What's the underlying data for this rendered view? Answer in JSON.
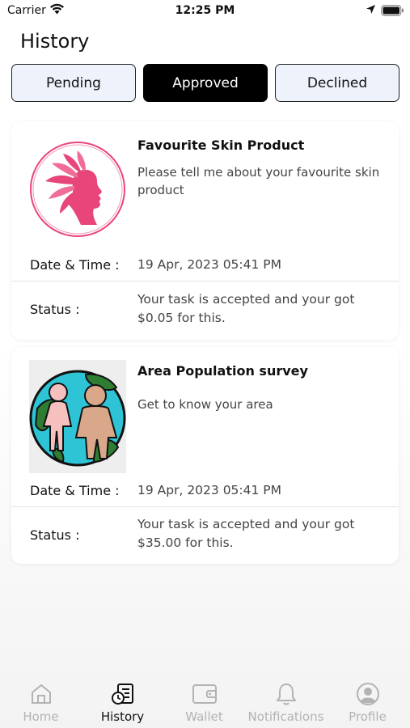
{
  "status_bar": {
    "carrier": "Carrier",
    "time": "12:25 PM"
  },
  "header": {
    "title": "History"
  },
  "segments": [
    {
      "label": "Pending",
      "active": false
    },
    {
      "label": "Approved",
      "active": true
    },
    {
      "label": "Declined",
      "active": false
    }
  ],
  "cards": [
    {
      "title": "Favourite Skin Product",
      "description": "Please tell me about your favourite skin product",
      "datetime_label": "Date & Time :",
      "datetime_value": "19 Apr, 2023 05:41 PM",
      "status_label": "Status :",
      "status_value": "Your task is accepted and your got $0.05 for this.",
      "image_icon": "woman-face-logo"
    },
    {
      "title": "Area Population survey",
      "description": "Get to know your area",
      "datetime_label": "Date & Time :",
      "datetime_value": "19 Apr, 2023 05:41 PM",
      "status_label": "Status :",
      "status_value": "Your task is accepted and your got $35.00 for this.",
      "image_icon": "globe-people-image"
    }
  ],
  "tab_bar": {
    "items": [
      {
        "label": "Home",
        "icon": "home-icon",
        "active": false
      },
      {
        "label": "History",
        "icon": "history-icon",
        "active": true
      },
      {
        "label": "Wallet",
        "icon": "wallet-icon",
        "active": false
      },
      {
        "label": "Notifications",
        "icon": "bell-icon",
        "active": false
      },
      {
        "label": "Profile",
        "icon": "profile-icon",
        "active": false
      }
    ]
  },
  "colors": {
    "accent": "#000000",
    "segment_bg": "#eef3fb",
    "logo_pink": "#e8457a",
    "inactive_tab": "#b3b3b3"
  }
}
